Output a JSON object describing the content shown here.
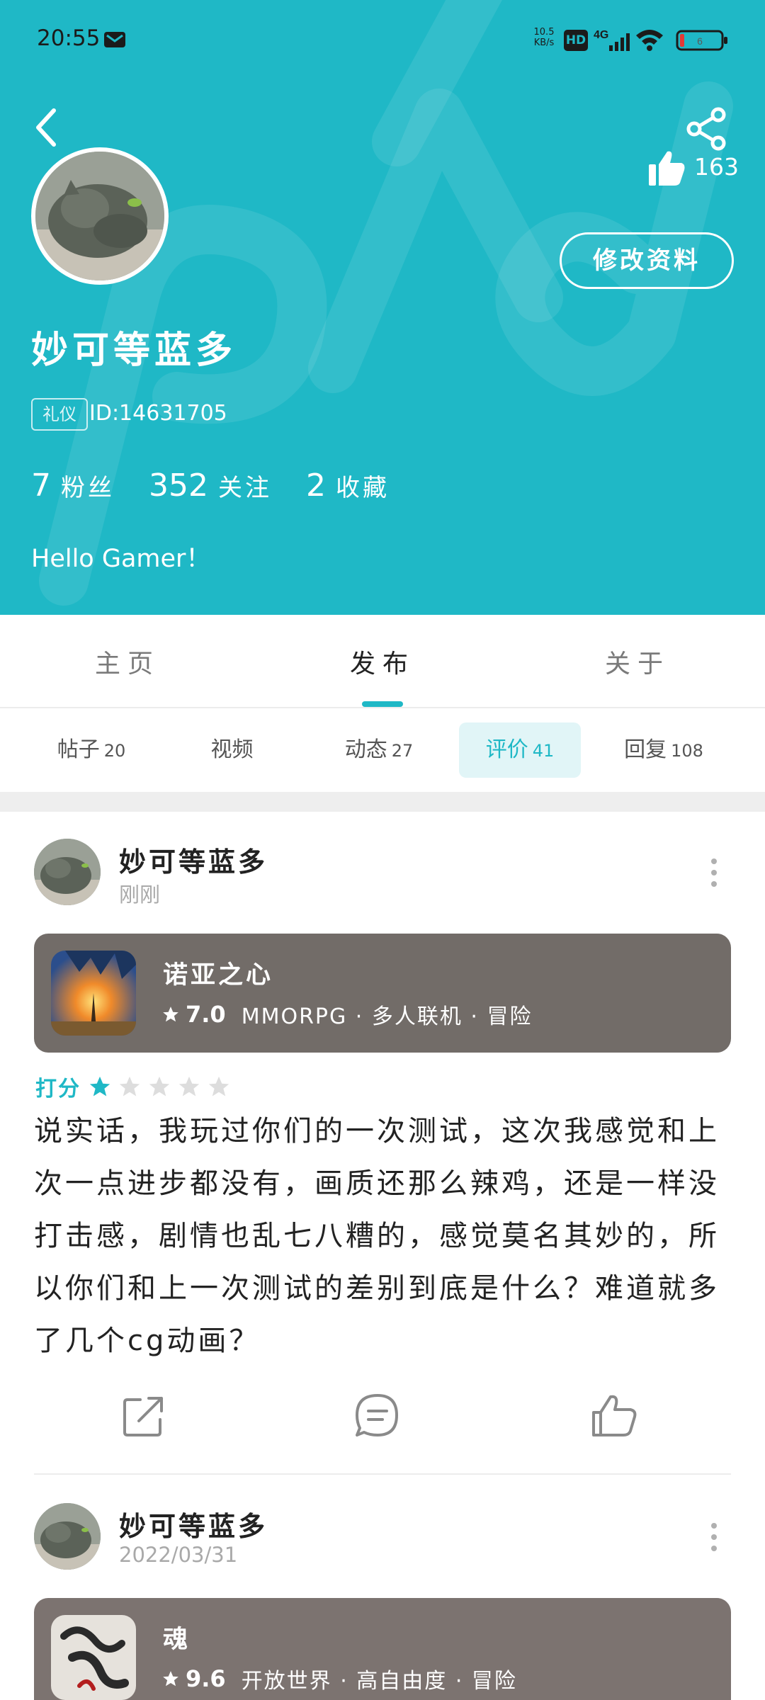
{
  "status_bar": {
    "time": "20:55",
    "net_speed_value": "10.5",
    "net_speed_unit": "KB/s",
    "hd": "HD",
    "network": "4G",
    "battery": "6"
  },
  "profile": {
    "like_count": "163",
    "edit_button": "修改资料",
    "username": "妙可等蓝多",
    "badge": "礼仪",
    "user_id": "ID:14631705",
    "stats": [
      {
        "num": "7",
        "label": "粉丝"
      },
      {
        "num": "352",
        "label": "关注"
      },
      {
        "num": "2",
        "label": "收藏"
      }
    ],
    "bio": "Hello Gamer！"
  },
  "tabs": [
    {
      "label": "主页",
      "active": false
    },
    {
      "label": "发布",
      "active": true
    },
    {
      "label": "关于",
      "active": false
    }
  ],
  "subtabs": [
    {
      "label": "帖子",
      "count": "20",
      "active": false
    },
    {
      "label": "视频",
      "count": "",
      "active": false
    },
    {
      "label": "动态",
      "count": "27",
      "active": false
    },
    {
      "label": "评价",
      "count": "41",
      "active": true
    },
    {
      "label": "回复",
      "count": "108",
      "active": false
    }
  ],
  "posts": [
    {
      "author": "妙可等蓝多",
      "time": "刚刚",
      "game": {
        "name": "诺亚之心",
        "score": "7.0",
        "tags": "MMORPG · 多人联机 · 冒险"
      },
      "rating_label": "打分",
      "rating": 1,
      "rating_max": 5,
      "text": "说实话，我玩过你们的一次测试，这次我感觉和上次一点进步都没有，画质还那么辣鸡，还是一样没打击感，剧情也乱七八糟的，感觉莫名其妙的，所以你们和上一次测试的差别到底是什么？难道就多了几个cg动画？"
    },
    {
      "author": "妙可等蓝多",
      "time": "2022/03/31",
      "game": {
        "name": "魂",
        "score": "9.6",
        "tags": "开放世界 · 高自由度 · 冒险"
      }
    }
  ],
  "colors": {
    "accent": "#1fb8c6",
    "star_inactive": "#dddddd",
    "card": "#726c68"
  },
  "icons": [
    "mail-icon",
    "back-icon",
    "share-icon",
    "thumbs-up-icon",
    "more-vertical-icon",
    "star-icon",
    "external-share-icon",
    "comment-icon"
  ]
}
